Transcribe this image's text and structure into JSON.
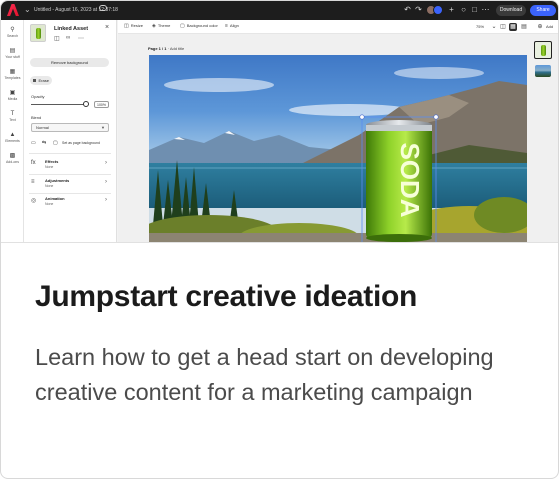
{
  "app": {
    "document_title": "Untitled - August 16, 2023 at 12:37:18",
    "download_label": "Download",
    "share_label": "Share"
  },
  "rail": {
    "items": [
      {
        "label": "Search",
        "icon": "search-icon"
      },
      {
        "label": "Your stuff",
        "icon": "folder-icon"
      },
      {
        "label": "Templates",
        "icon": "templates-icon"
      },
      {
        "label": "Media",
        "icon": "media-icon"
      },
      {
        "label": "Text",
        "icon": "text-icon"
      },
      {
        "label": "Elements",
        "icon": "elements-icon"
      },
      {
        "label": "Add-ons",
        "icon": "addons-icon"
      }
    ]
  },
  "panel": {
    "title": "Linked Asset",
    "remove_background_label": "Remove background",
    "erase_label": "Erase",
    "opacity_label": "Opacity",
    "opacity_value": "100%",
    "opacity_level": 1.0,
    "blend_label": "Blend",
    "blend_value": "Normal",
    "set_background_label": "Set as page background",
    "sections": [
      {
        "title": "Effects",
        "subtitle": "None",
        "icon": "effects-icon"
      },
      {
        "title": "Adjustments",
        "subtitle": "None",
        "icon": "adjustments-icon"
      },
      {
        "title": "Animation",
        "subtitle": "None",
        "icon": "animation-icon"
      }
    ]
  },
  "toolbar": {
    "resize_label": "Resize",
    "theme_label": "Theme",
    "background_color_label": "Background color",
    "align_label": "Align",
    "zoom": "75%",
    "add_label": "Add"
  },
  "canvas": {
    "page_label": "Page 1 / 1",
    "page_title_hint": "Add title",
    "can_text": "SODA"
  },
  "card": {
    "headline": "Jumpstart creative ideation",
    "description": "Learn how to get a head start on developing creative content for a marketing campaign"
  },
  "colors": {
    "topbar": "#1d1d1d",
    "share": "#3b63fb",
    "can_green": "#7cc21e"
  }
}
